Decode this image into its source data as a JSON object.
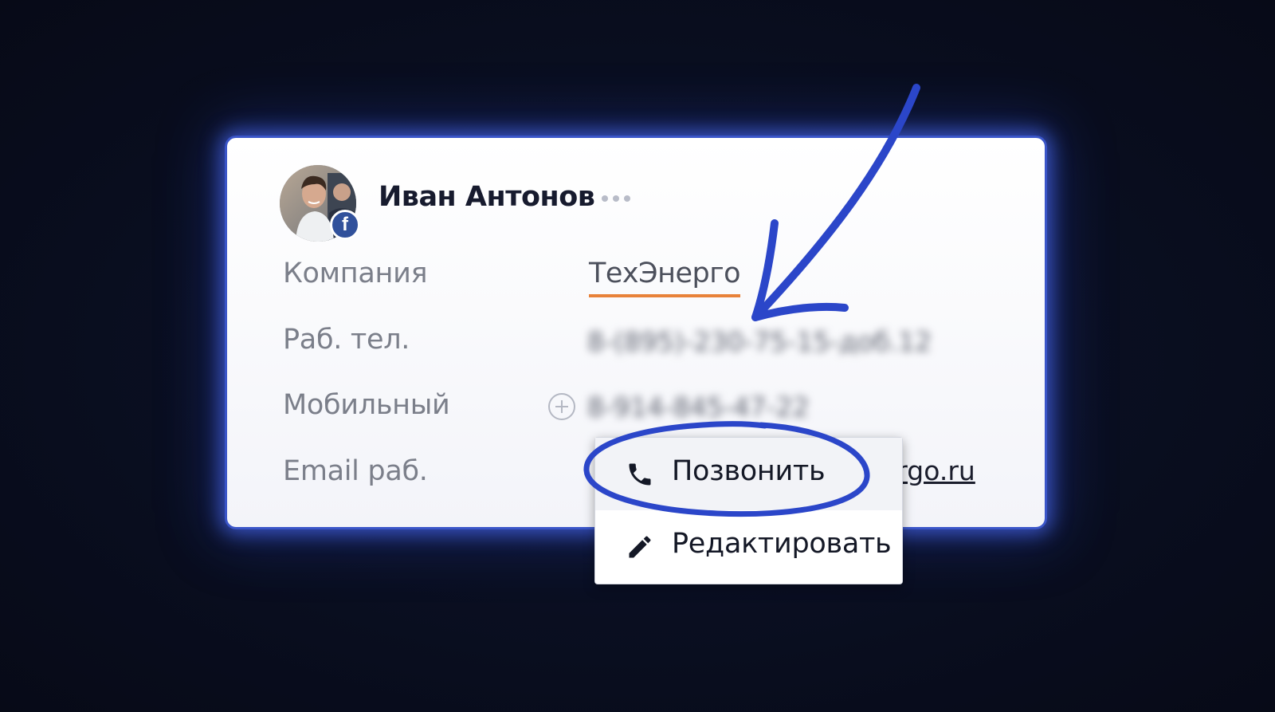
{
  "contact": {
    "name": "Иван Антонов",
    "badge_icon": "facebook-icon",
    "badge_letter": "f",
    "more_icon": "more-dots-icon"
  },
  "fields": {
    "company": {
      "label": "Компания",
      "value": "ТехЭнерго"
    },
    "work_phone": {
      "label": "Раб. тел.",
      "value": "8-(895)-230-75-15-доб.12"
    },
    "mobile": {
      "label": "Мобильный",
      "value": "8-914-845-47-22",
      "add_icon": "plus-circle-icon"
    },
    "work_email": {
      "label": "Email раб.",
      "value_visible": "ergo.ru"
    }
  },
  "context_menu": {
    "items": [
      {
        "label": "Позвонить",
        "icon": "phone-icon",
        "highlighted": true
      },
      {
        "label": "Редактировать",
        "icon": "pencil-icon",
        "highlighted": false
      }
    ]
  },
  "annotations": {
    "arrow_color": "#2b46c9",
    "circle_color": "#2b46c9",
    "underline_color": "#e8823a"
  },
  "colors": {
    "background": "#0a0f22",
    "card_border": "#3a55c8",
    "glow": "#4664e6",
    "facebook": "#31519b"
  }
}
